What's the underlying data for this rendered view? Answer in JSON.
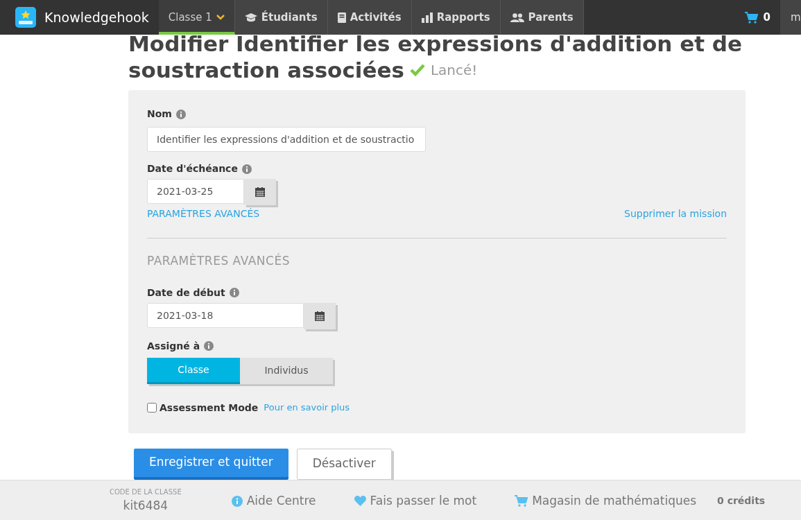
{
  "nav": {
    "brand": "Knowledgehook",
    "tabs": [
      {
        "label": "Classe 1",
        "selected": true
      },
      {
        "label": "Étudiants",
        "selected": false
      },
      {
        "label": "Activités",
        "selected": false
      },
      {
        "label": "Rapports",
        "selected": false
      },
      {
        "label": "Parents",
        "selected": false
      }
    ],
    "cart_count": "0",
    "user": "m"
  },
  "heading": {
    "title_line_1": "Modifier Identifier les expressions d'addition et de",
    "title_line_2": "soustraction associées",
    "status": "Lancé!"
  },
  "form": {
    "name_label": "Nom",
    "name_value": "Identifier les expressions d'addition et de soustractio",
    "due_label": "Date d'échéance",
    "due_value": "2021-03-25",
    "advanced_link": "PARAMÈTRES AVANCÉS",
    "delete_link": "Supprimer la mission",
    "advanced_heading": "PARAMÈTRES AVANCÉS",
    "start_label": "Date de début",
    "start_value": "2021-03-18",
    "assigned_label": "Assigné à",
    "assigned_options": [
      {
        "label": "Classe",
        "selected": true
      },
      {
        "label": "Individus",
        "selected": false
      }
    ],
    "assessment_label": "Assessment Mode",
    "assessment_checked": false,
    "learn_more": "Pour en savoir plus"
  },
  "buttons": {
    "save": "Enregistrer et quitter",
    "deactivate": "Désactiver"
  },
  "footer": {
    "code_label": "CODE DE LA CLASSE",
    "code": "kit6484",
    "items": [
      {
        "label": "Aide Centre"
      },
      {
        "label": "Fais passer le mot"
      },
      {
        "label": "Magasin de mathématiques"
      }
    ],
    "credits": "0 crédits"
  }
}
